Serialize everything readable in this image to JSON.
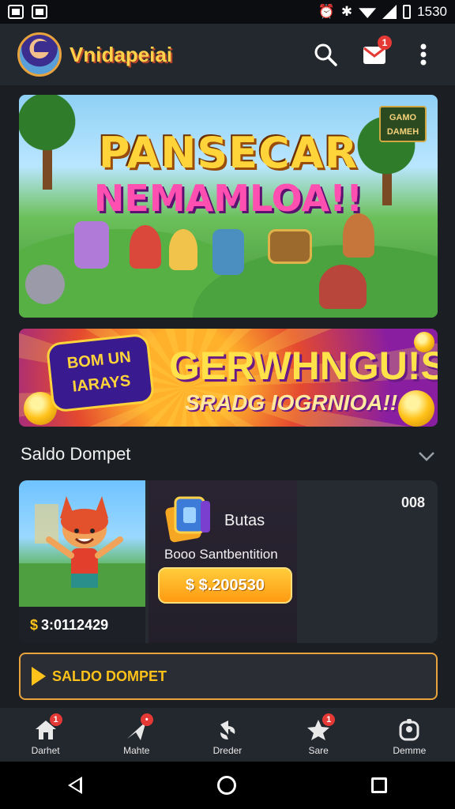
{
  "status_bar": {
    "time": "1530"
  },
  "header": {
    "brand": "Vnidapeiai",
    "notification_count": "1"
  },
  "hero_banner": {
    "title": "PANSECAR",
    "subtitle": "NEMAMLOA!!",
    "badge": "GAMO DAMEH"
  },
  "promo_banner": {
    "bubble_text": "BOM UN IARAYS",
    "title": "GERWHNGU!S",
    "subtitle": "SRADG IOGRNIOA!!"
  },
  "section": {
    "title": "Saldo Dompet"
  },
  "wallet": {
    "thumb_amount": "3:0112429",
    "currency_symbol": "$",
    "label": "Butas",
    "description": "Booo Santbentition",
    "balance": "$ $.200530",
    "code": "008"
  },
  "cta": {
    "label": "SALDO DOMPET"
  },
  "bottom_nav": {
    "items": [
      {
        "label": "Darhet",
        "badge": "1"
      },
      {
        "label": "Mahte",
        "badge": "•"
      },
      {
        "label": "Dreder",
        "badge": ""
      },
      {
        "label": "Sare",
        "badge": "1"
      },
      {
        "label": "Demme",
        "badge": ""
      }
    ]
  },
  "colors": {
    "background": "#1b1e23",
    "accent": "#ffc21a",
    "badge": "#e53935"
  }
}
